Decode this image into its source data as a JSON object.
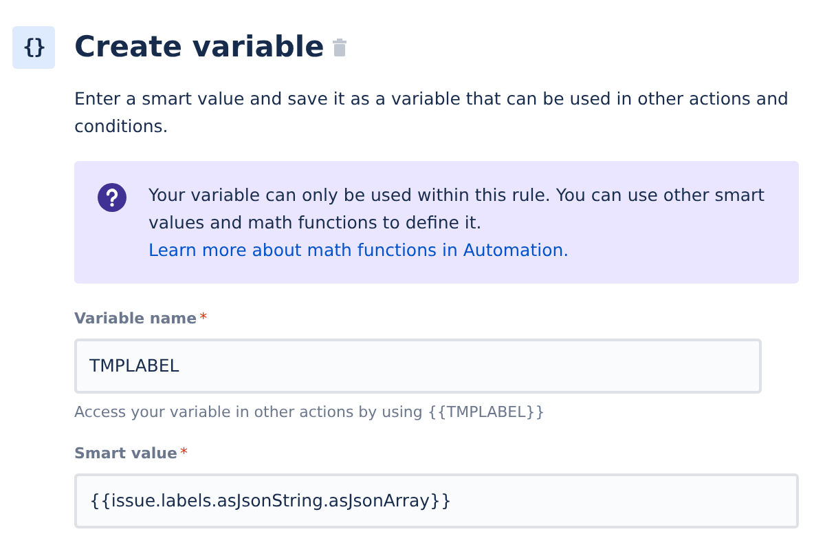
{
  "header": {
    "icon_glyph": "{}",
    "title": "Create variable",
    "description": "Enter a smart value and save it as a variable that can be used in other actions and conditions."
  },
  "info": {
    "text": "Your variable can only be used within this rule. You can use other smart values and math functions to define it.",
    "link": "Learn more about math functions in Automation."
  },
  "fields": [
    {
      "label": "Variable name",
      "required_mark": "*",
      "value": "TMPLABEL",
      "help": "Access your variable in other actions by using {{TMPLABEL}}",
      "wide": false
    },
    {
      "label": "Smart value",
      "required_mark": "*",
      "value": "{{issue.labels.asJsonString.asJsonArray}}",
      "wide": true
    }
  ]
}
